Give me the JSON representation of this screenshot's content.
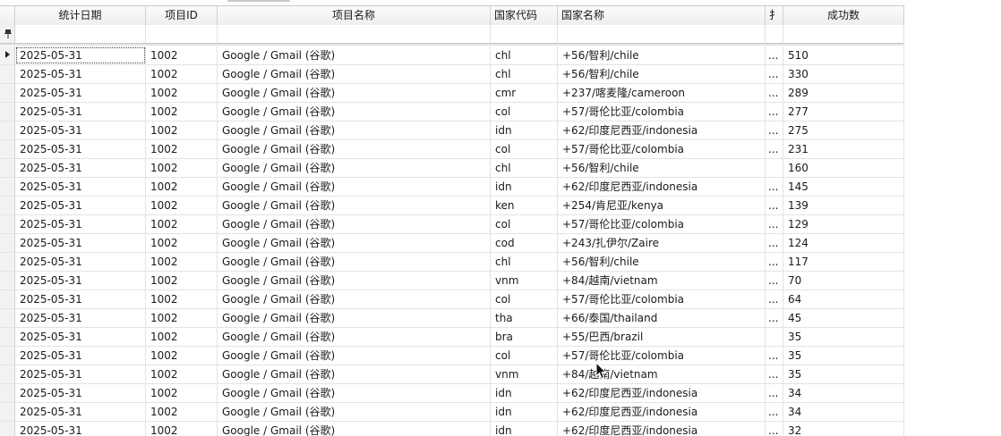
{
  "columns": {
    "date": "统计日期",
    "project_id": "项目ID",
    "project_name": "项目名称",
    "country_code": "国家代码",
    "country_name": "国家名称",
    "truncated": "扌",
    "success_count": "成功数"
  },
  "rows": [
    {
      "date": "2025-05-31",
      "project_id": "1002",
      "project_name": "Google / Gmail (谷歌)",
      "country_code": "chl",
      "country_name": "+56/智利/chile",
      "truncated": "...",
      "success_count": "510"
    },
    {
      "date": "2025-05-31",
      "project_id": "1002",
      "project_name": "Google / Gmail (谷歌)",
      "country_code": "chl",
      "country_name": "+56/智利/chile",
      "truncated": "...",
      "success_count": "330"
    },
    {
      "date": "2025-05-31",
      "project_id": "1002",
      "project_name": "Google / Gmail (谷歌)",
      "country_code": "cmr",
      "country_name": "+237/喀麦隆/cameroon",
      "truncated": "...",
      "success_count": "289"
    },
    {
      "date": "2025-05-31",
      "project_id": "1002",
      "project_name": "Google / Gmail (谷歌)",
      "country_code": "col",
      "country_name": "+57/哥伦比亚/colombia",
      "truncated": "...",
      "success_count": "277"
    },
    {
      "date": "2025-05-31",
      "project_id": "1002",
      "project_name": "Google / Gmail (谷歌)",
      "country_code": "idn",
      "country_name": "+62/印度尼西亚/indonesia",
      "truncated": "...",
      "success_count": "275"
    },
    {
      "date": "2025-05-31",
      "project_id": "1002",
      "project_name": "Google / Gmail (谷歌)",
      "country_code": "col",
      "country_name": "+57/哥伦比亚/colombia",
      "truncated": "...",
      "success_count": "231"
    },
    {
      "date": "2025-05-31",
      "project_id": "1002",
      "project_name": "Google / Gmail (谷歌)",
      "country_code": "chl",
      "country_name": "+56/智利/chile",
      "truncated": "",
      "success_count": "160"
    },
    {
      "date": "2025-05-31",
      "project_id": "1002",
      "project_name": "Google / Gmail (谷歌)",
      "country_code": "idn",
      "country_name": "+62/印度尼西亚/indonesia",
      "truncated": "...",
      "success_count": "145"
    },
    {
      "date": "2025-05-31",
      "project_id": "1002",
      "project_name": "Google / Gmail (谷歌)",
      "country_code": "ken",
      "country_name": "+254/肯尼亚/kenya",
      "truncated": "...",
      "success_count": "139"
    },
    {
      "date": "2025-05-31",
      "project_id": "1002",
      "project_name": "Google / Gmail (谷歌)",
      "country_code": "col",
      "country_name": "+57/哥伦比亚/colombia",
      "truncated": "...",
      "success_count": "129"
    },
    {
      "date": "2025-05-31",
      "project_id": "1002",
      "project_name": "Google / Gmail (谷歌)",
      "country_code": "cod",
      "country_name": "+243/扎伊尔/Zaire",
      "truncated": "...",
      "success_count": "124"
    },
    {
      "date": "2025-05-31",
      "project_id": "1002",
      "project_name": "Google / Gmail (谷歌)",
      "country_code": "chl",
      "country_name": "+56/智利/chile",
      "truncated": "...",
      "success_count": "117"
    },
    {
      "date": "2025-05-31",
      "project_id": "1002",
      "project_name": "Google / Gmail (谷歌)",
      "country_code": "vnm",
      "country_name": "+84/越南/vietnam",
      "truncated": "...",
      "success_count": "70"
    },
    {
      "date": "2025-05-31",
      "project_id": "1002",
      "project_name": "Google / Gmail (谷歌)",
      "country_code": "col",
      "country_name": "+57/哥伦比亚/colombia",
      "truncated": "...",
      "success_count": "64"
    },
    {
      "date": "2025-05-31",
      "project_id": "1002",
      "project_name": "Google / Gmail (谷歌)",
      "country_code": "tha",
      "country_name": "+66/泰国/thailand",
      "truncated": "...",
      "success_count": "45"
    },
    {
      "date": "2025-05-31",
      "project_id": "1002",
      "project_name": "Google / Gmail (谷歌)",
      "country_code": "bra",
      "country_name": "+55/巴西/brazil",
      "truncated": "",
      "success_count": "35"
    },
    {
      "date": "2025-05-31",
      "project_id": "1002",
      "project_name": "Google / Gmail (谷歌)",
      "country_code": "col",
      "country_name": "+57/哥伦比亚/colombia",
      "truncated": "...",
      "success_count": "35"
    },
    {
      "date": "2025-05-31",
      "project_id": "1002",
      "project_name": "Google / Gmail (谷歌)",
      "country_code": "vnm",
      "country_name": "+84/越南/vietnam",
      "truncated": "...",
      "success_count": "35"
    },
    {
      "date": "2025-05-31",
      "project_id": "1002",
      "project_name": "Google / Gmail (谷歌)",
      "country_code": "idn",
      "country_name": "+62/印度尼西亚/indonesia",
      "truncated": "...",
      "success_count": "34"
    },
    {
      "date": "2025-05-31",
      "project_id": "1002",
      "project_name": "Google / Gmail (谷歌)",
      "country_code": "idn",
      "country_name": "+62/印度尼西亚/indonesia",
      "truncated": "...",
      "success_count": "34"
    },
    {
      "date": "2025-05-31",
      "project_id": "1002",
      "project_name": "Google / Gmail (谷歌)",
      "country_code": "idn",
      "country_name": "+62/印度尼西亚/indonesia",
      "truncated": "...",
      "success_count": "32"
    }
  ],
  "selected_row": 0,
  "icons": {
    "filter_row": "pin-icon",
    "current_row": "row-indicator-arrow-icon",
    "mouse": "mouse-cursor-icon"
  }
}
